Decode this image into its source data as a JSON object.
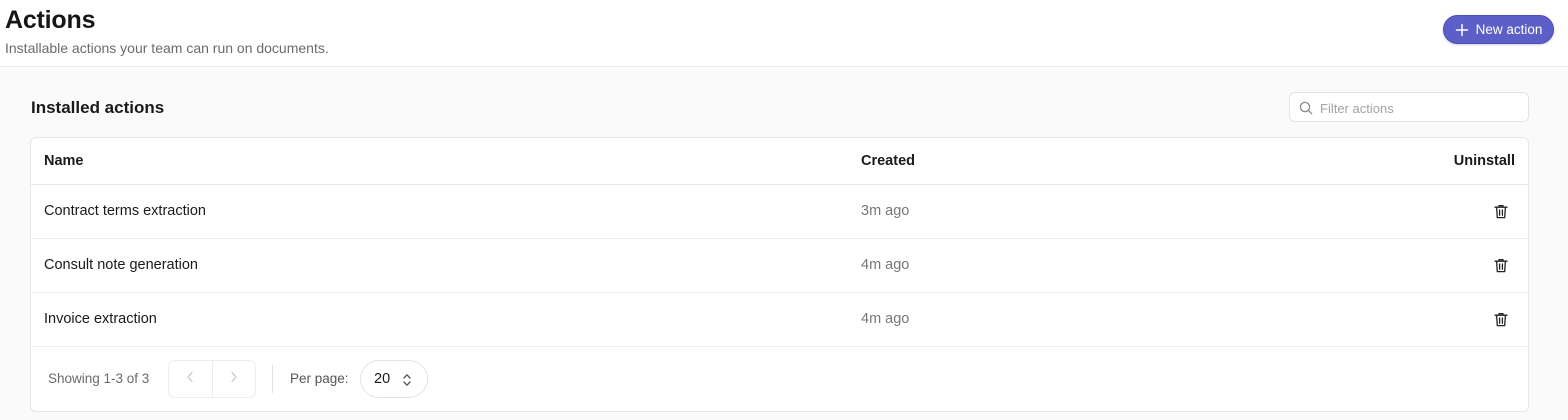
{
  "header": {
    "title": "Actions",
    "subtitle": "Installable actions your team can run on documents.",
    "new_action_label": "New action"
  },
  "section": {
    "title": "Installed actions",
    "filter_placeholder": "Filter actions"
  },
  "table": {
    "columns": {
      "name": "Name",
      "created": "Created",
      "uninstall": "Uninstall"
    },
    "rows": [
      {
        "name": "Contract terms extraction",
        "created": "3m ago"
      },
      {
        "name": "Consult note generation",
        "created": "4m ago"
      },
      {
        "name": "Invoice extraction",
        "created": "4m ago"
      }
    ]
  },
  "pagination": {
    "showing": "Showing 1-3 of 3",
    "per_page_label": "Per page:",
    "per_page_value": "20"
  },
  "colors": {
    "accent": "#5b5fc7",
    "background": "#fafafa"
  },
  "icons": {
    "new_action": "plus-icon",
    "filter": "search-icon",
    "row_action": "trash-icon",
    "pager_prev": "chevron-left-icon",
    "pager_next": "chevron-right-icon",
    "select": "chevron-up-down-icon"
  }
}
